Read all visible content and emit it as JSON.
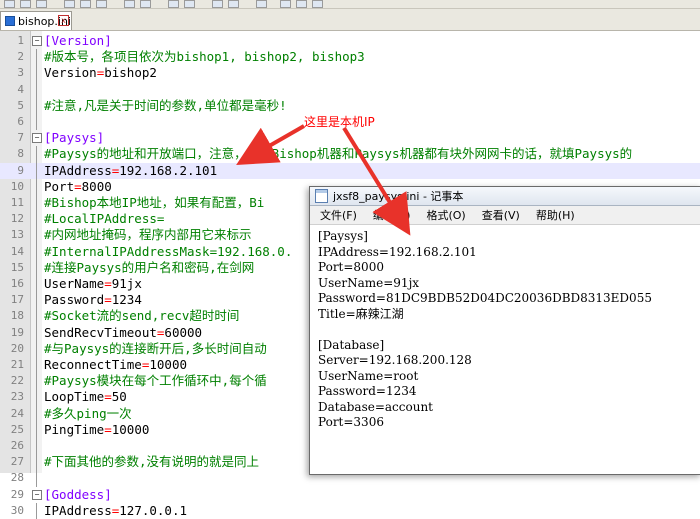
{
  "editor": {
    "tab_label": "bishop.ini",
    "tab_close": "x",
    "lines": [
      {
        "n": "1",
        "fold": "minus",
        "parts": [
          [
            "sec",
            "[Version]"
          ]
        ]
      },
      {
        "n": "2",
        "parts": [
          [
            "cmt",
            "#版本号，各项目依次为bishop1, bishop2, bishop3"
          ]
        ]
      },
      {
        "n": "3",
        "parts": [
          [
            "key",
            "Version"
          ],
          [
            "eq",
            "="
          ],
          [
            "val",
            "bishop2"
          ]
        ]
      },
      {
        "n": "4",
        "parts": []
      },
      {
        "n": "5",
        "parts": [
          [
            "cmt",
            "#注意,凡是关于时间的参数,单位都是毫秒!"
          ]
        ]
      },
      {
        "n": "6",
        "parts": []
      },
      {
        "n": "7",
        "fold": "minus",
        "parts": [
          [
            "sec",
            "[Paysys]"
          ]
        ]
      },
      {
        "n": "8",
        "parts": [
          [
            "cmt",
            "#Paysys的地址和开放端口，注意，如果Bishop机器和Paysys机器都有块外网网卡的话，就填Paysys的"
          ]
        ]
      },
      {
        "n": "9",
        "current": true,
        "parts": [
          [
            "key",
            "IPAddress"
          ],
          [
            "eq",
            "="
          ],
          [
            "val",
            "192.168.2.101"
          ]
        ]
      },
      {
        "n": "10",
        "parts": [
          [
            "key",
            "Port"
          ],
          [
            "eq",
            "="
          ],
          [
            "val",
            "8000"
          ]
        ]
      },
      {
        "n": "11",
        "parts": [
          [
            "cmt",
            "#Bishop本地IP地址，如果有配置，Bi"
          ]
        ]
      },
      {
        "n": "12",
        "parts": [
          [
            "cmt",
            "#LocalIPAddress="
          ]
        ]
      },
      {
        "n": "13",
        "parts": [
          [
            "cmt",
            "#内网地址掩码，程序内部用它来标示"
          ]
        ]
      },
      {
        "n": "14",
        "parts": [
          [
            "cmt",
            "#InternalIPAddressMask=192.168.0."
          ]
        ]
      },
      {
        "n": "15",
        "parts": [
          [
            "cmt",
            "#连接Paysys的用户名和密码,在剑网"
          ]
        ]
      },
      {
        "n": "16",
        "parts": [
          [
            "key",
            "UserName"
          ],
          [
            "eq",
            "="
          ],
          [
            "val",
            "91jx"
          ]
        ]
      },
      {
        "n": "17",
        "parts": [
          [
            "key",
            "Password"
          ],
          [
            "eq",
            "="
          ],
          [
            "val",
            "1234"
          ]
        ]
      },
      {
        "n": "18",
        "parts": [
          [
            "cmt",
            "#Socket流的send,recv超时时间"
          ]
        ]
      },
      {
        "n": "19",
        "parts": [
          [
            "key",
            "SendRecvTimeout"
          ],
          [
            "eq",
            "="
          ],
          [
            "val",
            "60000"
          ]
        ]
      },
      {
        "n": "20",
        "parts": [
          [
            "cmt",
            "#与Paysys的连接断开后,多长时间自动"
          ]
        ]
      },
      {
        "n": "21",
        "parts": [
          [
            "key",
            "ReconnectTime"
          ],
          [
            "eq",
            "="
          ],
          [
            "val",
            "10000"
          ]
        ]
      },
      {
        "n": "22",
        "parts": [
          [
            "cmt",
            "#Paysys模块在每个工作循环中,每个循"
          ]
        ]
      },
      {
        "n": "23",
        "parts": [
          [
            "key",
            "LoopTime"
          ],
          [
            "eq",
            "="
          ],
          [
            "val",
            "50"
          ]
        ]
      },
      {
        "n": "24",
        "parts": [
          [
            "cmt",
            "#多久ping一次"
          ]
        ]
      },
      {
        "n": "25",
        "parts": [
          [
            "key",
            "PingTime"
          ],
          [
            "eq",
            "="
          ],
          [
            "val",
            "10000"
          ]
        ]
      },
      {
        "n": "26",
        "parts": []
      },
      {
        "n": "27",
        "parts": [
          [
            "cmt",
            "#下面其他的参数,没有说明的就是同上"
          ]
        ]
      },
      {
        "n": "28",
        "parts": []
      },
      {
        "n": "29",
        "fold": "minus",
        "parts": [
          [
            "sec",
            "[Goddess]"
          ]
        ]
      },
      {
        "n": "30",
        "parts": [
          [
            "key",
            "IPAddress"
          ],
          [
            "eq",
            "="
          ],
          [
            "val",
            "127.0.0.1"
          ]
        ]
      }
    ]
  },
  "annotation": {
    "text": "这里是本机IP",
    "color": "#ff0000"
  },
  "notepad": {
    "title": "jxsf8_paysys.ini - 记事本",
    "menu": [
      "文件(F)",
      "编辑(E)",
      "格式(O)",
      "查看(V)",
      "帮助(H)"
    ],
    "content": "[Paysys]\nIPAddress=192.168.2.101\nPort=8000\nUserName=91jx\nPassword=81DC9BDB52D04DC20036DBD8313ED055\nTitle=麻辣江湖\n\n[Database]\nServer=192.168.200.128\nUserName=root\nPassword=1234\nDatabase=account\nPort=3306"
  },
  "colors": {
    "section": "#8000ff",
    "comment": "#008000",
    "operator": "#ff0000",
    "arrow": "#e8322a"
  },
  "icons": {
    "tab_save": "save-icon",
    "tab_close": "close-icon",
    "notepad": "notepad-icon"
  }
}
